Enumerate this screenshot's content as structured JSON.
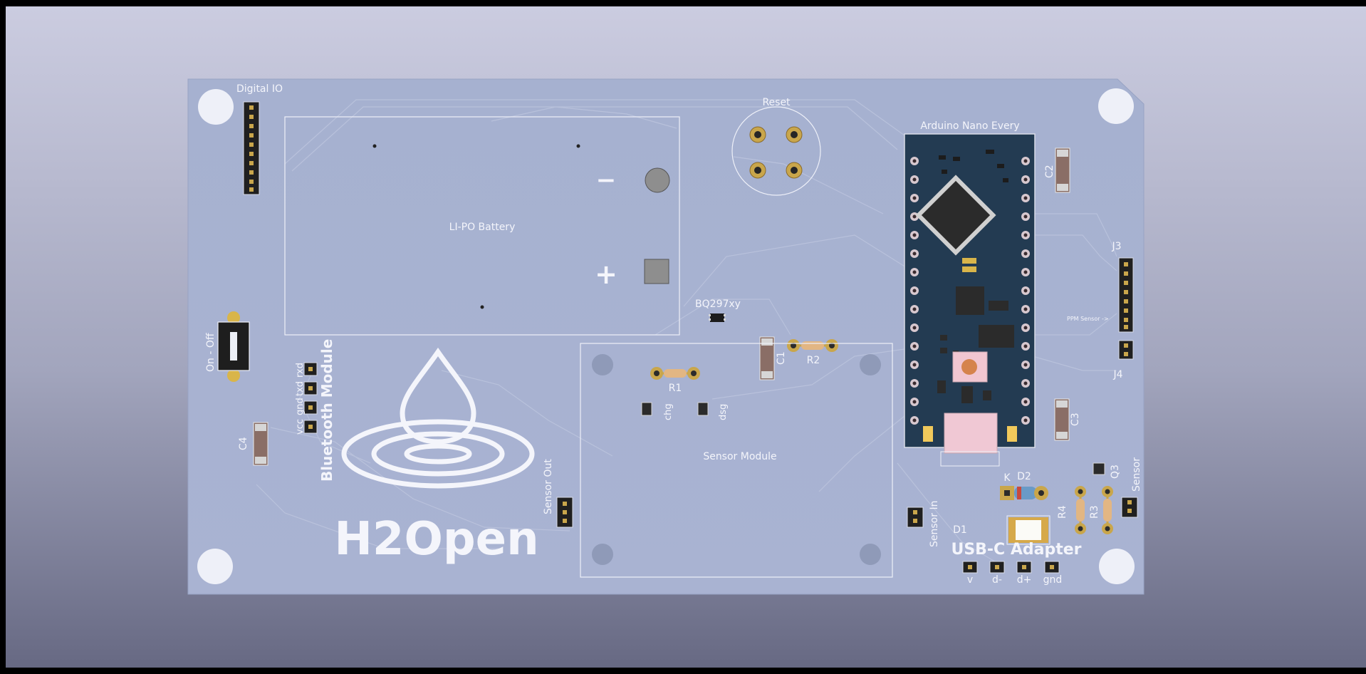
{
  "board": {
    "labels": {
      "digital_io": "Digital IO",
      "battery": "LI-PO Battery",
      "battery_minus": "−",
      "battery_plus": "+",
      "reset": "Reset",
      "arduino": "Arduino Nano Every",
      "bq": "BQ297xy",
      "r1": "R1",
      "r2": "R2",
      "c1": "C1",
      "c2": "C2",
      "c3": "C3",
      "c4": "C4",
      "chg": "chg",
      "dsg": "dsg",
      "sensor_module": "Sensor Module",
      "sensor_out": "Sensor Out",
      "sensor_in": "Sensor In",
      "sensor": "Sensor",
      "ppm_sensor": "PPM Sensor ->",
      "j3": "J3",
      "j4": "J4",
      "q3": "Q3",
      "r3": "R3",
      "r4": "R4",
      "k": "K",
      "d1": "D1",
      "d2": "D2",
      "usb_c": "USB-C Adapter",
      "usb_v": "v",
      "usb_dminus": "d-",
      "usb_dplus": "d+",
      "usb_gnd": "gnd",
      "on_off": "On - Off",
      "bluetooth": "Bluetooth Module",
      "bt_vcc": "vcc",
      "bt_gnd": "gnd",
      "bt_txd": "txd",
      "bt_rxd": "rxd",
      "logo": "H2Open"
    }
  },
  "colors": {
    "background_top": "#c9cade",
    "background_bottom": "#6b6d86",
    "board": "#a9b4d2",
    "silkscreen": "#f4f5fb",
    "arduino": "#243d55",
    "pad": "#d9b54a"
  }
}
